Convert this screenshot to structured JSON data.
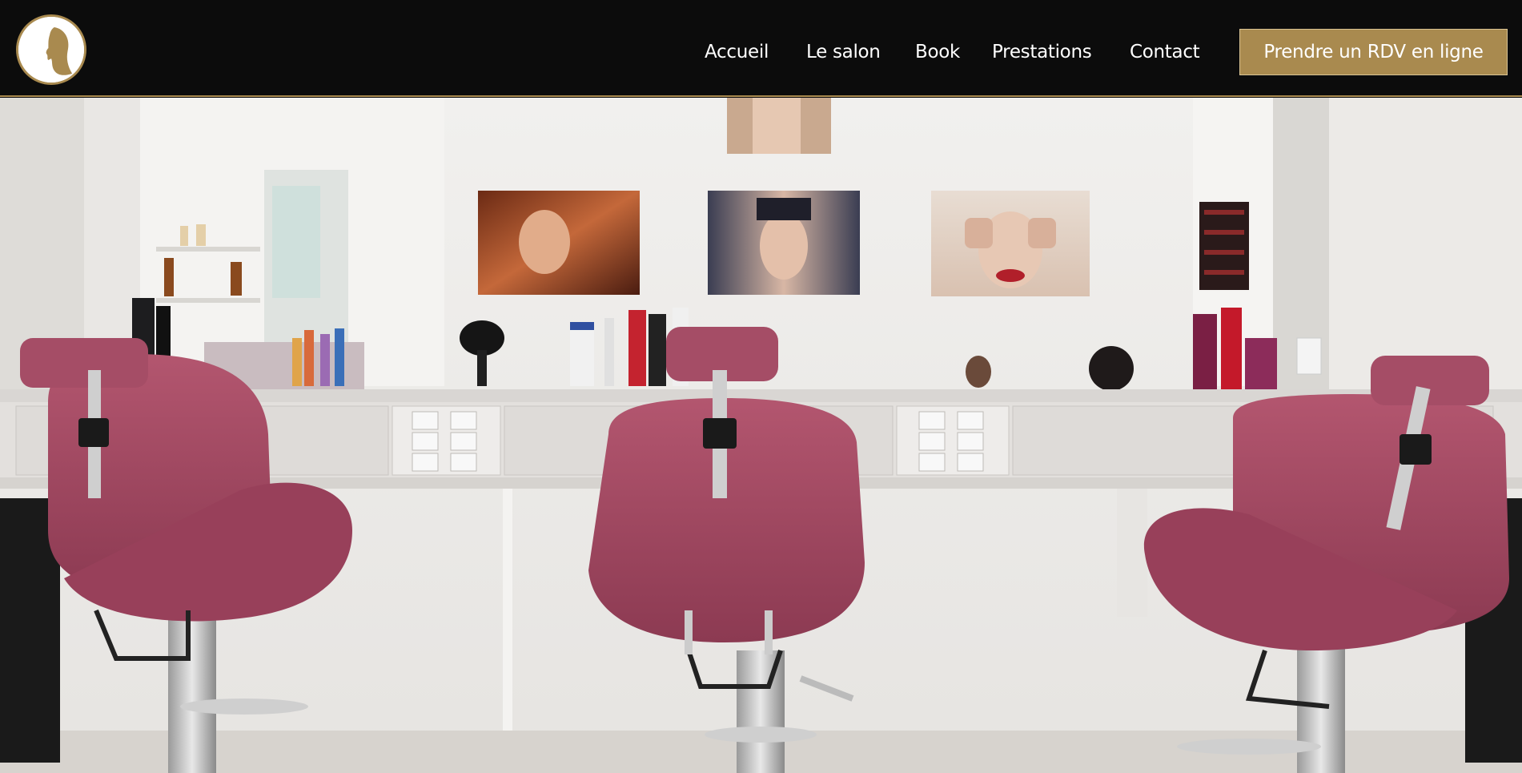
{
  "header": {
    "logo_icon": "woman-silhouette-logo",
    "nav": [
      {
        "label": "Accueil"
      },
      {
        "label": "Le salon"
      },
      {
        "label": "Book"
      },
      {
        "label": "Prestations"
      },
      {
        "label": "Contact"
      }
    ],
    "cta_label": "Prendre un RDV en ligne"
  },
  "colors": {
    "header_bg": "#0c0c0c",
    "accent_gold": "#a98a4f",
    "nav_text": "#ffffff",
    "chair_burgundy": "#a34a63"
  },
  "hero": {
    "image_subject": "salon-interior-photo"
  }
}
